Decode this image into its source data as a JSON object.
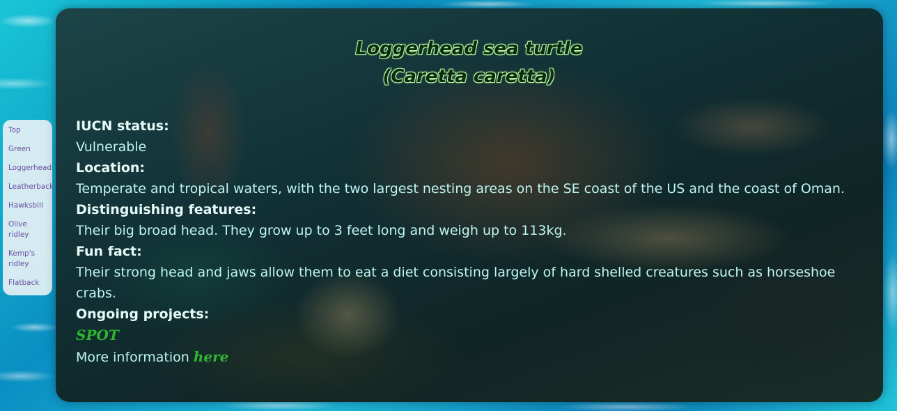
{
  "nav": {
    "items": [
      {
        "label": "Top"
      },
      {
        "label": "Green"
      },
      {
        "label": "Loggerhead"
      },
      {
        "label": "Leatherback"
      },
      {
        "label": "Hawksbill"
      },
      {
        "label": "Olive ridley"
      },
      {
        "label": "Kemp's ridley"
      },
      {
        "label": "Flatback"
      }
    ]
  },
  "card": {
    "title": "Loggerhead sea turtle",
    "scientific_name": "(Caretta caretta)",
    "iucn_label": "IUCN status:",
    "iucn_value": "Vulnerable",
    "location_label": "Location:",
    "location_value": "Temperate and tropical waters, with the two largest nesting areas on the SE coast of the US and the coast of Oman.",
    "features_label": "Distinguishing features:",
    "features_value": "Their big broad head. They grow up to 3 feet long and weigh up to 113kg.",
    "funfact_label": "Fun fact:",
    "funfact_value": "Their strong head and jaws allow them to eat a diet consisting largely of hard shelled creatures such as horseshoe crabs.",
    "projects_label": "Ongoing projects:",
    "project_link": "SPOT",
    "more_info_text": "More information",
    "more_info_link": "here"
  },
  "colors": {
    "nav_link": "#6b4fa0",
    "body_text": "#bff5f0",
    "link_green": "#2fb530"
  }
}
